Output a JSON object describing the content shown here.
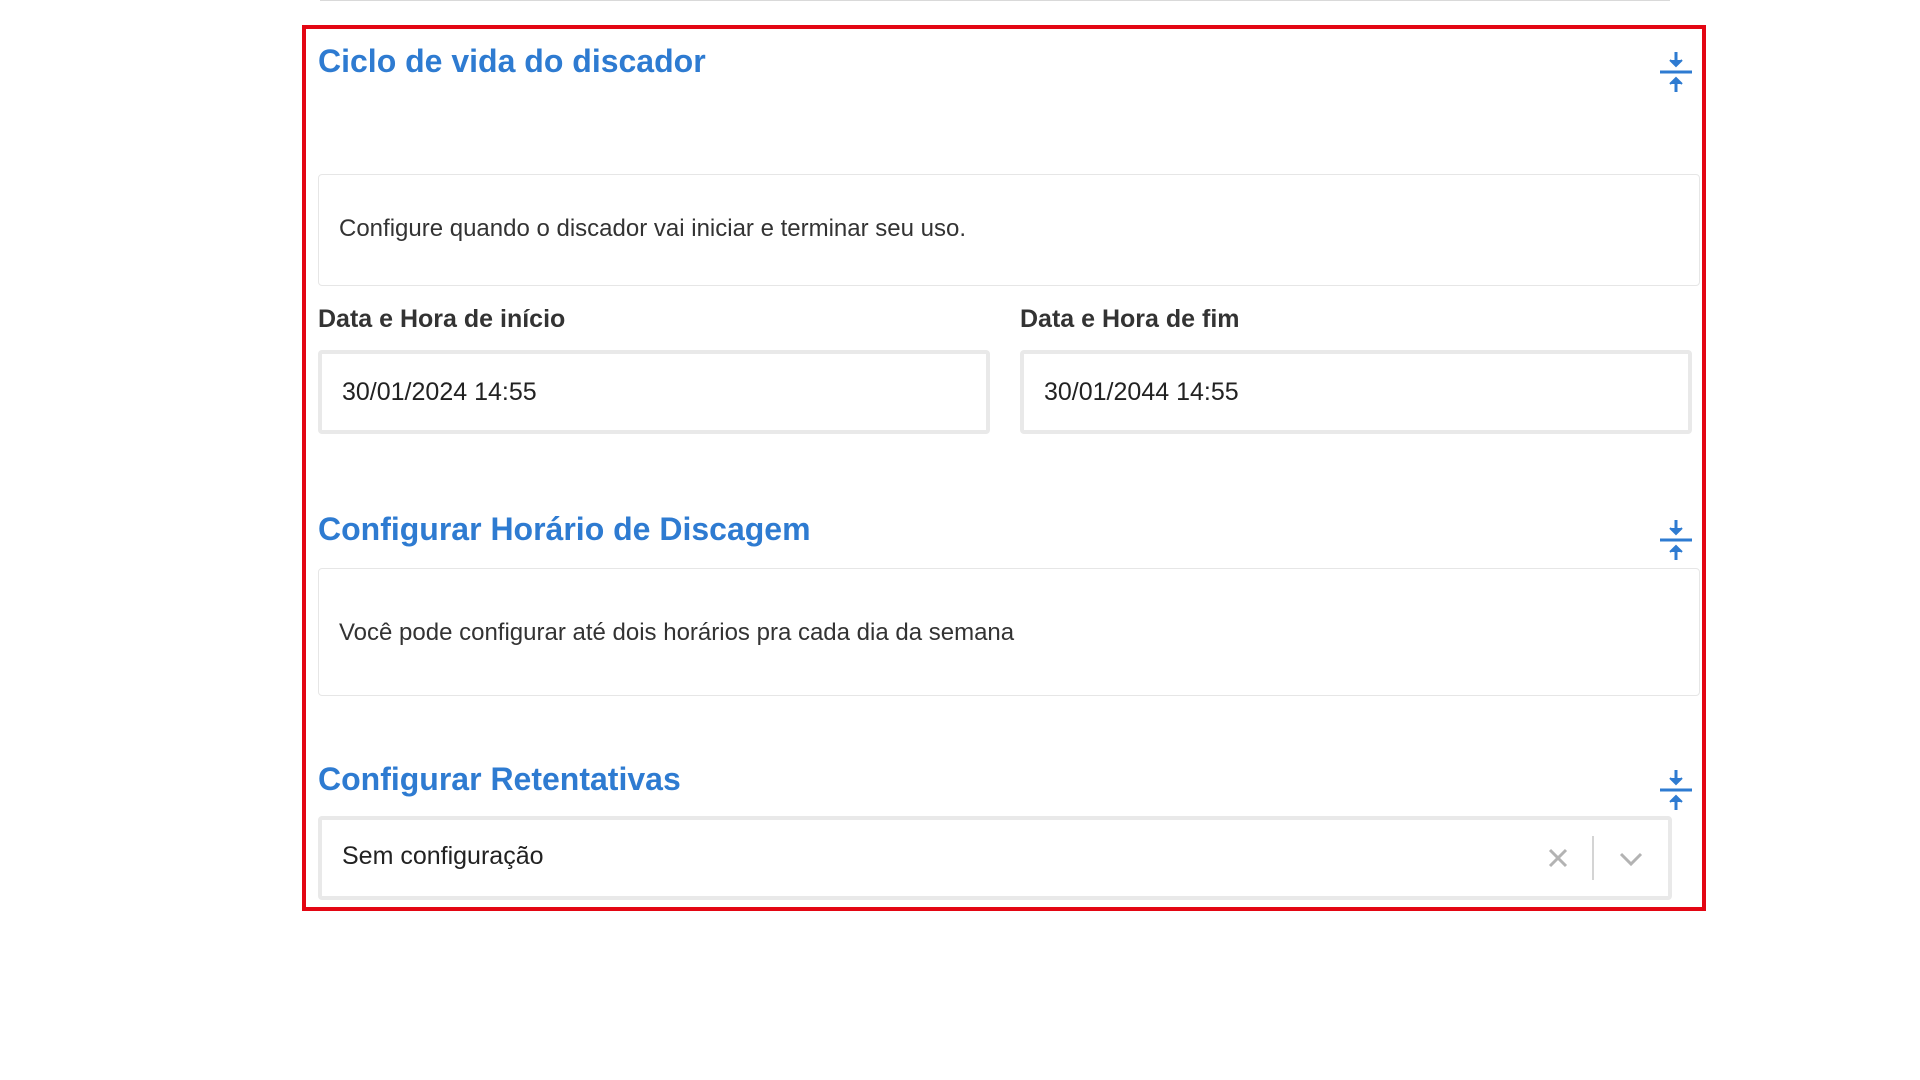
{
  "lifecycle": {
    "title": "Ciclo de vida do discador",
    "description": "Configure quando o discador vai iniciar e terminar seu uso.",
    "start_label": "Data e Hora de início",
    "start_value": "30/01/2024 14:55",
    "end_label": "Data e Hora de fim",
    "end_value": "30/01/2044 14:55",
    "collapse_icon": "collapse-vertical-icon"
  },
  "schedule": {
    "title": "Configurar Horário de Discagem",
    "description": "Você pode configurar até dois horários pra cada dia da semana",
    "collapse_icon": "collapse-vertical-icon"
  },
  "retries": {
    "title": "Configurar Retentativas",
    "selected_value": "Sem configuração",
    "clear_icon": "close-icon",
    "dropdown_icon": "chevron-down-icon",
    "collapse_icon": "collapse-vertical-icon"
  },
  "colors": {
    "accent": "#2e7bd1",
    "highlight_border": "#e30613",
    "input_border": "#e9e9e9",
    "text": "#333333"
  }
}
